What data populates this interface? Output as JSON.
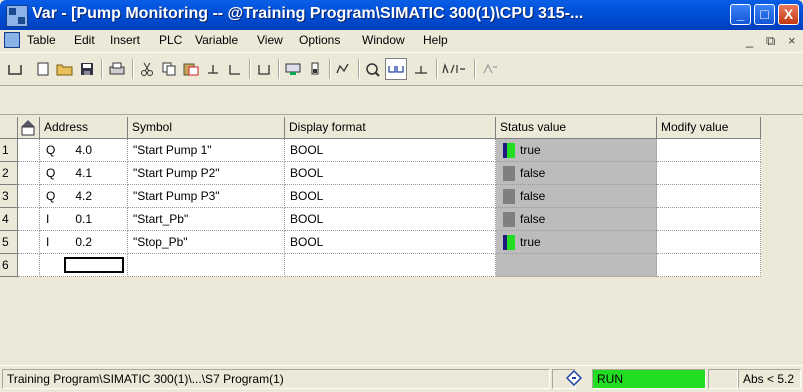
{
  "window": {
    "title": "Var - [Pump Monitoring -- @Training Program\\SIMATIC 300(1)\\CPU 315-...",
    "minimize_glyph": "_",
    "maximize_glyph": "□",
    "close_glyph": "X"
  },
  "menu": {
    "items": [
      "Table",
      "Edit",
      "Insert",
      "PLC",
      "Variable",
      "View",
      "Options",
      "Window",
      "Help"
    ],
    "doc_minimize": "_",
    "doc_restore": "⧉",
    "doc_close": "×"
  },
  "toolbar": {
    "icons": [
      "insert-row-icon",
      "new-table-icon",
      "open-icon",
      "save-icon",
      "print-icon",
      "cut-icon",
      "copy-icon",
      "paste-icon",
      "undo-icon",
      "redo-icon",
      "find-icon",
      "monitor-online-icon",
      "trigger-icon",
      "monitor-icon",
      "modify-icon",
      "update-icon",
      "force-icon",
      "help-icon"
    ]
  },
  "table": {
    "headers": [
      "Address",
      "Symbol",
      "Display format",
      "Status value",
      "Modify value"
    ],
    "rows": [
      {
        "num": "1",
        "type": "Q",
        "addr": "4.0",
        "symbol": "\"Start Pump 1\"",
        "format": "BOOL",
        "status": "true",
        "on": true
      },
      {
        "num": "2",
        "type": "Q",
        "addr": "4.1",
        "symbol": "\"Start Pump P2\"",
        "format": "BOOL",
        "status": "false",
        "on": false
      },
      {
        "num": "3",
        "type": "Q",
        "addr": "4.2",
        "symbol": "\"Start Pump P3\"",
        "format": "BOOL",
        "status": "false",
        "on": false
      },
      {
        "num": "4",
        "type": "I",
        "addr": "0.1",
        "symbol": "\"Start_Pb\"",
        "format": "BOOL",
        "status": "false",
        "on": false
      },
      {
        "num": "5",
        "type": "I",
        "addr": "0.2",
        "symbol": "\"Stop_Pb\"",
        "format": "BOOL",
        "status": "true",
        "on": true
      },
      {
        "num": "6",
        "type": "",
        "addr": "",
        "symbol": "",
        "format": "",
        "status": "",
        "on": null
      }
    ]
  },
  "statusbar": {
    "path": "Training Program\\SIMATIC 300(1)\\...\\S7 Program(1)",
    "mode": "RUN",
    "mode_color": "#22dd22",
    "abs": "Abs < 5.2"
  }
}
